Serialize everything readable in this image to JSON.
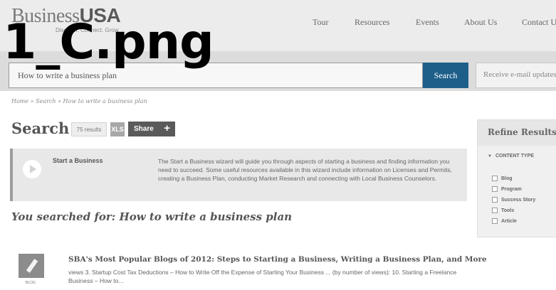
{
  "overlay_label": "1_C.png",
  "header": {
    "logo_light": "Business",
    "logo_bold": "USA",
    "tagline": "Discover. Connect. Grow",
    "nav": [
      "Tour",
      "Resources",
      "Events",
      "About Us",
      "Contact Us"
    ]
  },
  "search": {
    "query": "How to write a business plan",
    "button_label": "Search",
    "email_placeholder": "Receive e-mail updates"
  },
  "breadcrumb": [
    "Home",
    "Search",
    "How to write a business plan"
  ],
  "results_header": {
    "title": "Search",
    "count": "75 results",
    "xl_label": "XLS",
    "share_label": "Share",
    "share_plus": "+"
  },
  "wizard": {
    "title": "Start a Business",
    "description": "The Start a Business wizard will guide you through aspects of starting a business and finding information you need to succeed. Some useful resources available in this wizard include information on Licenses and Permits, creating a Business Plan, conducting Market Research and connecting with Local Business Counselors."
  },
  "you_searched": "You searched for: How to write a business plan",
  "refine": {
    "title": "Refine Results",
    "facet_title": "CONTENT TYPE",
    "options": [
      "Blog",
      "Program",
      "Success Story",
      "Tools",
      "Article"
    ]
  },
  "results": [
    {
      "type_label": "BLOG",
      "title": "SBA's Most Popular Blogs of 2012: Steps to Starting a Business, Writing a Business Plan, and More",
      "snippet": "views 3.     Startup Cost Tax Deductions – How to Write Off the Expense of Starting Your Business ... (by number of views): 10. Starting a Freelance Business – How to..."
    }
  ]
}
